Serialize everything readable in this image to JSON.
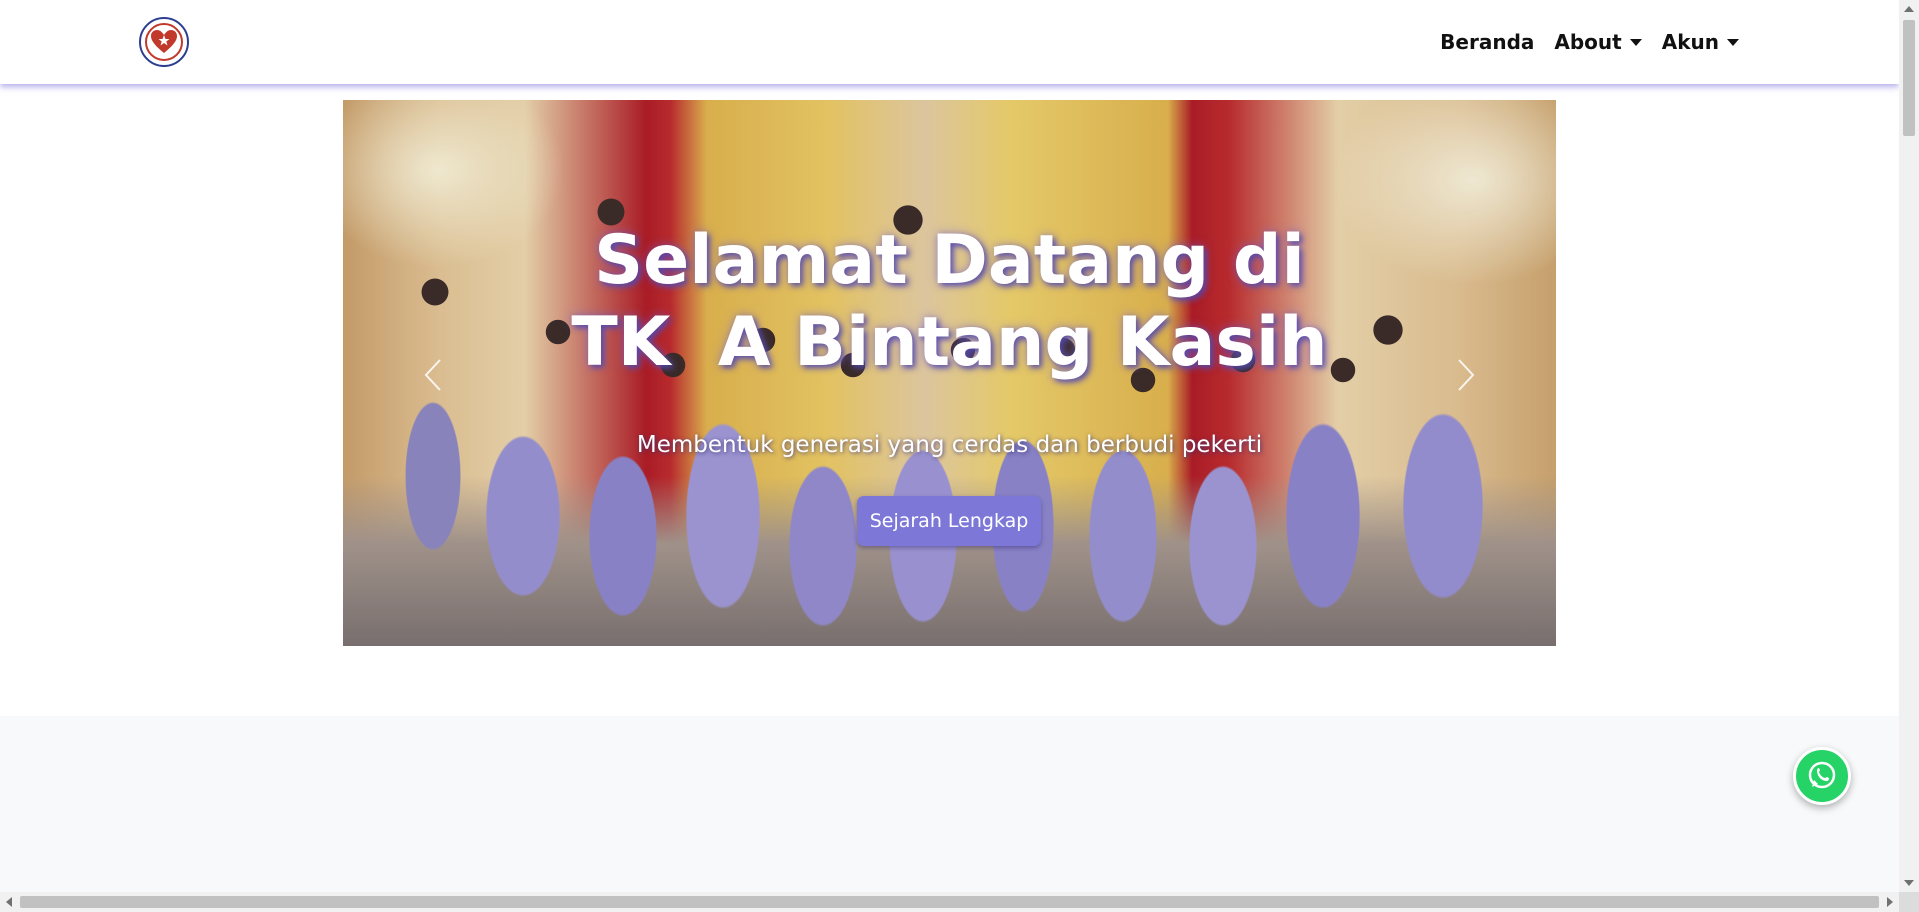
{
  "navbar": {
    "logo_icon": "school-logo-heart-icon",
    "items": [
      {
        "label": "Beranda",
        "dropdown": false
      },
      {
        "label": "About",
        "dropdown": true
      },
      {
        "label": "Akun",
        "dropdown": true
      }
    ]
  },
  "hero": {
    "title_line1": "Selamat Datang di",
    "title_line2": "TK  A Bintang Kasih",
    "subtitle": "Membentuk generasi yang cerdas dan berbudi pekerti",
    "button_label": "Sejarah Lengkap",
    "prev_icon": "chevron-left-icon",
    "next_icon": "chevron-right-icon"
  },
  "floating": {
    "whatsapp_icon": "whatsapp-icon"
  },
  "colors": {
    "accent": "#7d78d8",
    "navbar_shadow": "#786edc",
    "whatsapp": "#25d366",
    "section_gray": "#f8f9fa"
  }
}
